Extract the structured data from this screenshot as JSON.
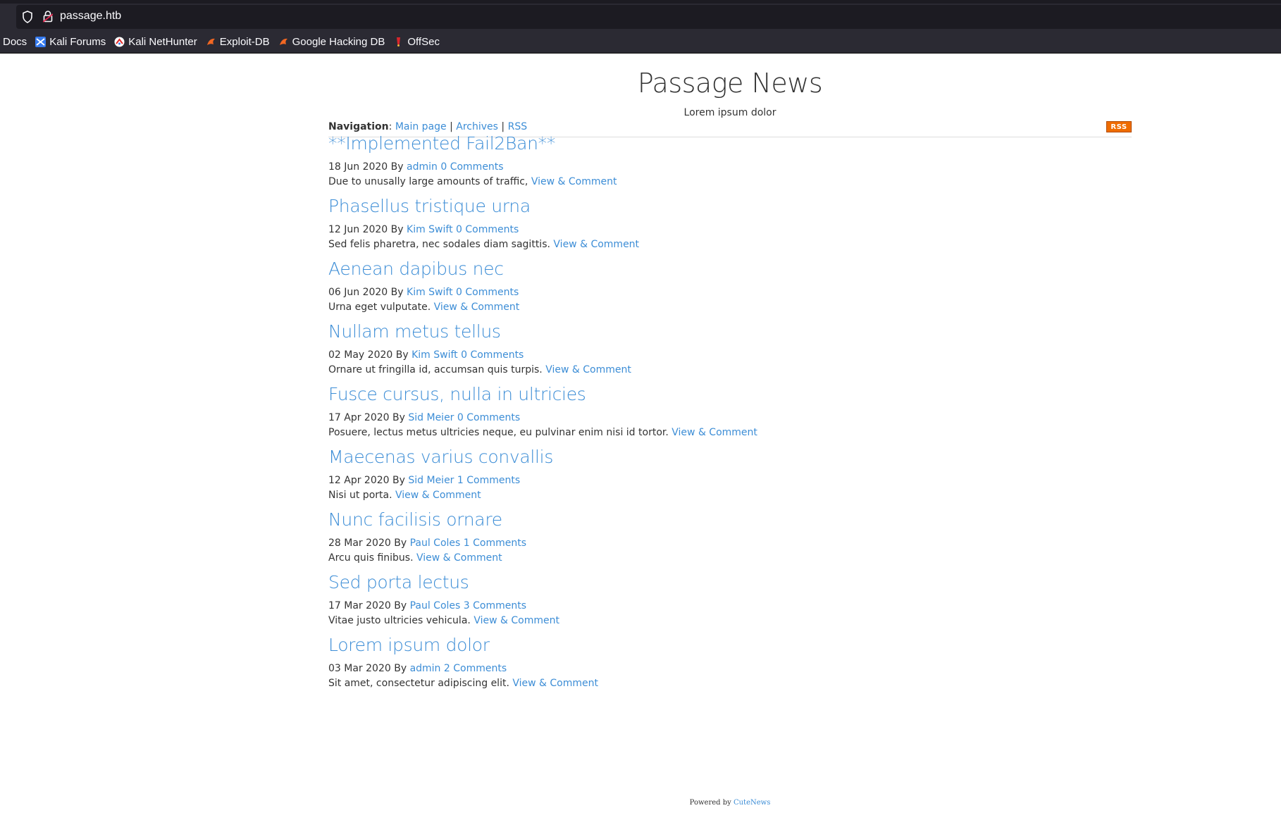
{
  "browser": {
    "url": "passage.htb",
    "bookmarks": [
      {
        "label": "Docs",
        "icon": "none"
      },
      {
        "label": "Kali Forums",
        "icon": "kali-forums-icon"
      },
      {
        "label": "Kali NetHunter",
        "icon": "kali-nethunter-icon"
      },
      {
        "label": "Exploit-DB",
        "icon": "exploit-db-icon"
      },
      {
        "label": "Google Hacking DB",
        "icon": "ghdb-icon"
      },
      {
        "label": "OffSec",
        "icon": "offsec-icon"
      }
    ]
  },
  "site": {
    "title": "Passage News",
    "subtitle": "Lorem ipsum dolor",
    "nav_label": "Navigation",
    "nav_sep": ":",
    "nav_links": [
      "Main page",
      "Archives",
      "RSS"
    ],
    "rss_badge": "RSS"
  },
  "posts": [
    {
      "title": "**Implemented Fail2Ban**",
      "date": "18 Jun 2020",
      "by": "By",
      "author": "admin",
      "comments": "0 Comments",
      "body": "Due to unusally large amounts of traffic,",
      "link": "View & Comment"
    },
    {
      "title": "Phasellus tristique urna",
      "date": "12 Jun 2020",
      "by": "By",
      "author": "Kim Swift",
      "comments": "0 Comments",
      "body": "Sed felis pharetra, nec sodales diam sagittis.",
      "link": "View & Comment"
    },
    {
      "title": "Aenean dapibus nec",
      "date": "06 Jun 2020",
      "by": "By",
      "author": "Kim Swift",
      "comments": "0 Comments",
      "body": "Urna eget vulputate.",
      "link": "View & Comment"
    },
    {
      "title": "Nullam metus tellus",
      "date": "02 May 2020",
      "by": "By",
      "author": "Kim Swift",
      "comments": "0 Comments",
      "body": "Ornare ut fringilla id, accumsan quis turpis.",
      "link": "View & Comment"
    },
    {
      "title": "Fusce cursus, nulla in ultricies",
      "date": "17 Apr 2020",
      "by": "By",
      "author": "Sid Meier",
      "comments": "0 Comments",
      "body": "Posuere, lectus metus ultricies neque, eu pulvinar enim nisi id tortor.",
      "link": "View & Comment"
    },
    {
      "title": "Maecenas varius convallis",
      "date": "12 Apr 2020",
      "by": "By",
      "author": "Sid Meier",
      "comments": "1 Comments",
      "body": "Nisi ut porta.",
      "link": "View & Comment"
    },
    {
      "title": "Nunc facilisis ornare",
      "date": "28 Mar 2020",
      "by": "By",
      "author": "Paul Coles",
      "comments": "1 Comments",
      "body": "Arcu quis finibus.",
      "link": "View & Comment"
    },
    {
      "title": "Sed porta lectus",
      "date": "17 Mar 2020",
      "by": "By",
      "author": "Paul Coles",
      "comments": "3 Comments",
      "body": "Vitae justo ultricies vehicula.",
      "link": "View & Comment"
    },
    {
      "title": "Lorem ipsum dolor",
      "date": "03 Mar 2020",
      "by": "By",
      "author": "admin",
      "comments": "2 Comments",
      "body": "Sit amet, consectetur adipiscing elit.",
      "link": "View & Comment"
    }
  ],
  "footer": {
    "prefix": "Powered by",
    "link": "CuteNews"
  }
}
